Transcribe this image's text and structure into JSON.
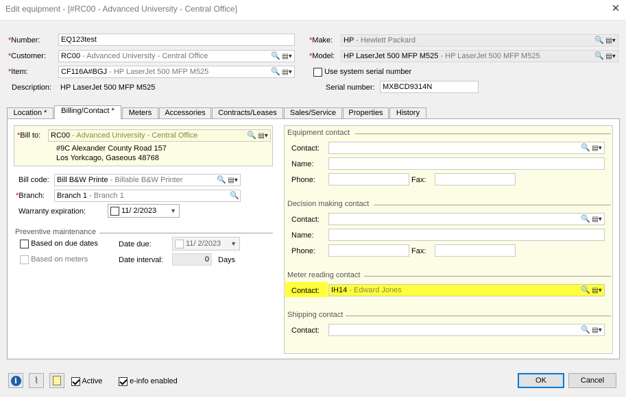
{
  "window": {
    "title": "Edit equipment - [#RC00 - Advanced University - Central Office]",
    "close_glyph": "✕"
  },
  "header": {
    "number": {
      "label": "Number:",
      "value": "EQ123test"
    },
    "customer": {
      "label": "Customer:",
      "code": "RC00",
      "desc": " - Advanced University - Central Office"
    },
    "item": {
      "label": "Item:",
      "code": "CF116A#BGJ",
      "desc": " - HP LaserJet 500 MFP M525"
    },
    "description": {
      "label": "Description:",
      "value": "HP LaserJet 500 MFP M525"
    },
    "make": {
      "label": "Make:",
      "code": "HP",
      "desc": " - Hewlett Packard"
    },
    "model": {
      "label": "Model:",
      "code": "HP LaserJet 500 MFP M525",
      "desc": " - HP LaserJet 500 MFP M525"
    },
    "use_system_serial": {
      "label": "Use system serial number",
      "checked": false
    },
    "serial": {
      "label": "Serial number:",
      "value": "MXBCD9314N"
    }
  },
  "tabs": [
    {
      "label": "Location *"
    },
    {
      "label": "Billing/Contact *"
    },
    {
      "label": "Meters"
    },
    {
      "label": "Accessories"
    },
    {
      "label": "Contracts/Leases"
    },
    {
      "label": "Sales/Service"
    },
    {
      "label": "Properties"
    },
    {
      "label": "History"
    }
  ],
  "active_tab": "Billing/Contact *",
  "billing": {
    "bill_to": {
      "label": "Bill to:",
      "code": "RC00",
      "desc": " - Advanced University - Central Office",
      "address1": "#9C Alexander County Road 157",
      "address2": "Los Yorkcago, Gaseous 48768"
    },
    "bill_code": {
      "label": "Bill code:",
      "code": "Bill B&W Printe",
      "desc": " - Billable B&W Printer"
    },
    "branch": {
      "label": "Branch:",
      "code": "Branch 1",
      "desc": " - Branch 1"
    },
    "warranty": {
      "label": "Warranty expiration:",
      "value": "11/  2/2023",
      "checked": false
    }
  },
  "preventive": {
    "title": "Preventive maintenance",
    "due_dates": {
      "label": "Based on due dates",
      "checked": false
    },
    "meters": {
      "label": "Based on meters",
      "checked": false
    },
    "date_due": {
      "label": "Date due:",
      "value": "11/  2/2023"
    },
    "date_interval": {
      "label": "Date interval:",
      "value": "0",
      "unit": "Days"
    }
  },
  "contacts": {
    "equipment": {
      "title": "Equipment contact",
      "contact_label": "Contact:",
      "name_label": "Name:",
      "phone_label": "Phone:",
      "fax_label": "Fax:"
    },
    "decision": {
      "title": "Decision making contact",
      "contact_label": "Contact:",
      "name_label": "Name:",
      "phone_label": "Phone:",
      "fax_label": "Fax:"
    },
    "meter": {
      "title": "Meter reading contact",
      "contact_label": "Contact:",
      "code": "IH14",
      "desc": " - Edward Jones",
      "highlight_color": "#ffff3b"
    },
    "shipping": {
      "title": "Shipping contact",
      "contact_label": "Contact:"
    }
  },
  "footer": {
    "active": {
      "label": "Active",
      "checked": true
    },
    "einfo": {
      "label": "e-info enabled",
      "checked": true
    },
    "ok_label": "OK",
    "cancel_label": "Cancel"
  },
  "icons": {
    "search": "magnifier-icon",
    "picker": "picker-dropdown-icon",
    "info": "info-icon",
    "attach": "paperclip-icon",
    "notes": "notes-icon"
  },
  "colors": {
    "required": "#d00000",
    "bill_to_bg": "#fdfde5",
    "default_button_border": "#0078d7"
  }
}
